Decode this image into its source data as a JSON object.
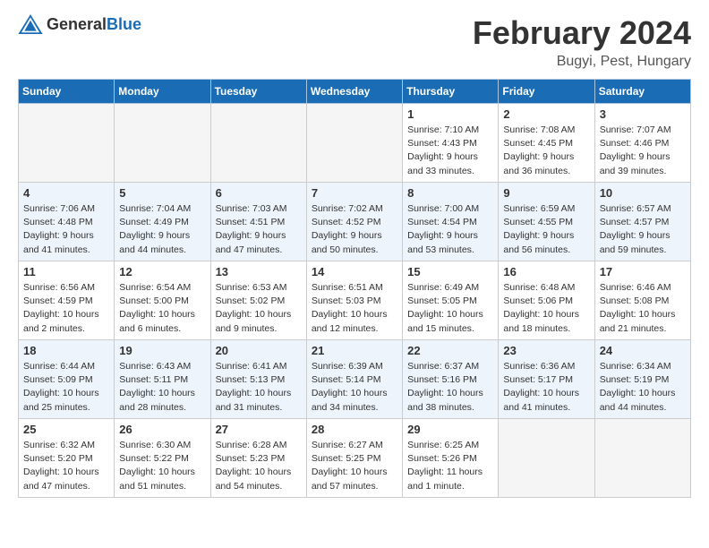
{
  "header": {
    "logo_general": "General",
    "logo_blue": "Blue",
    "month_title": "February 2024",
    "location": "Bugyi, Pest, Hungary"
  },
  "columns": [
    "Sunday",
    "Monday",
    "Tuesday",
    "Wednesday",
    "Thursday",
    "Friday",
    "Saturday"
  ],
  "weeks": [
    [
      {
        "day": "",
        "empty": true
      },
      {
        "day": "",
        "empty": true
      },
      {
        "day": "",
        "empty": true
      },
      {
        "day": "",
        "empty": true
      },
      {
        "day": "1",
        "sunrise": "Sunrise: 7:10 AM",
        "sunset": "Sunset: 4:43 PM",
        "daylight": "Daylight: 9 hours and 33 minutes."
      },
      {
        "day": "2",
        "sunrise": "Sunrise: 7:08 AM",
        "sunset": "Sunset: 4:45 PM",
        "daylight": "Daylight: 9 hours and 36 minutes."
      },
      {
        "day": "3",
        "sunrise": "Sunrise: 7:07 AM",
        "sunset": "Sunset: 4:46 PM",
        "daylight": "Daylight: 9 hours and 39 minutes."
      }
    ],
    [
      {
        "day": "4",
        "sunrise": "Sunrise: 7:06 AM",
        "sunset": "Sunset: 4:48 PM",
        "daylight": "Daylight: 9 hours and 41 minutes."
      },
      {
        "day": "5",
        "sunrise": "Sunrise: 7:04 AM",
        "sunset": "Sunset: 4:49 PM",
        "daylight": "Daylight: 9 hours and 44 minutes."
      },
      {
        "day": "6",
        "sunrise": "Sunrise: 7:03 AM",
        "sunset": "Sunset: 4:51 PM",
        "daylight": "Daylight: 9 hours and 47 minutes."
      },
      {
        "day": "7",
        "sunrise": "Sunrise: 7:02 AM",
        "sunset": "Sunset: 4:52 PM",
        "daylight": "Daylight: 9 hours and 50 minutes."
      },
      {
        "day": "8",
        "sunrise": "Sunrise: 7:00 AM",
        "sunset": "Sunset: 4:54 PM",
        "daylight": "Daylight: 9 hours and 53 minutes."
      },
      {
        "day": "9",
        "sunrise": "Sunrise: 6:59 AM",
        "sunset": "Sunset: 4:55 PM",
        "daylight": "Daylight: 9 hours and 56 minutes."
      },
      {
        "day": "10",
        "sunrise": "Sunrise: 6:57 AM",
        "sunset": "Sunset: 4:57 PM",
        "daylight": "Daylight: 9 hours and 59 minutes."
      }
    ],
    [
      {
        "day": "11",
        "sunrise": "Sunrise: 6:56 AM",
        "sunset": "Sunset: 4:59 PM",
        "daylight": "Daylight: 10 hours and 2 minutes."
      },
      {
        "day": "12",
        "sunrise": "Sunrise: 6:54 AM",
        "sunset": "Sunset: 5:00 PM",
        "daylight": "Daylight: 10 hours and 6 minutes."
      },
      {
        "day": "13",
        "sunrise": "Sunrise: 6:53 AM",
        "sunset": "Sunset: 5:02 PM",
        "daylight": "Daylight: 10 hours and 9 minutes."
      },
      {
        "day": "14",
        "sunrise": "Sunrise: 6:51 AM",
        "sunset": "Sunset: 5:03 PM",
        "daylight": "Daylight: 10 hours and 12 minutes."
      },
      {
        "day": "15",
        "sunrise": "Sunrise: 6:49 AM",
        "sunset": "Sunset: 5:05 PM",
        "daylight": "Daylight: 10 hours and 15 minutes."
      },
      {
        "day": "16",
        "sunrise": "Sunrise: 6:48 AM",
        "sunset": "Sunset: 5:06 PM",
        "daylight": "Daylight: 10 hours and 18 minutes."
      },
      {
        "day": "17",
        "sunrise": "Sunrise: 6:46 AM",
        "sunset": "Sunset: 5:08 PM",
        "daylight": "Daylight: 10 hours and 21 minutes."
      }
    ],
    [
      {
        "day": "18",
        "sunrise": "Sunrise: 6:44 AM",
        "sunset": "Sunset: 5:09 PM",
        "daylight": "Daylight: 10 hours and 25 minutes."
      },
      {
        "day": "19",
        "sunrise": "Sunrise: 6:43 AM",
        "sunset": "Sunset: 5:11 PM",
        "daylight": "Daylight: 10 hours and 28 minutes."
      },
      {
        "day": "20",
        "sunrise": "Sunrise: 6:41 AM",
        "sunset": "Sunset: 5:13 PM",
        "daylight": "Daylight: 10 hours and 31 minutes."
      },
      {
        "day": "21",
        "sunrise": "Sunrise: 6:39 AM",
        "sunset": "Sunset: 5:14 PM",
        "daylight": "Daylight: 10 hours and 34 minutes."
      },
      {
        "day": "22",
        "sunrise": "Sunrise: 6:37 AM",
        "sunset": "Sunset: 5:16 PM",
        "daylight": "Daylight: 10 hours and 38 minutes."
      },
      {
        "day": "23",
        "sunrise": "Sunrise: 6:36 AM",
        "sunset": "Sunset: 5:17 PM",
        "daylight": "Daylight: 10 hours and 41 minutes."
      },
      {
        "day": "24",
        "sunrise": "Sunrise: 6:34 AM",
        "sunset": "Sunset: 5:19 PM",
        "daylight": "Daylight: 10 hours and 44 minutes."
      }
    ],
    [
      {
        "day": "25",
        "sunrise": "Sunrise: 6:32 AM",
        "sunset": "Sunset: 5:20 PM",
        "daylight": "Daylight: 10 hours and 47 minutes."
      },
      {
        "day": "26",
        "sunrise": "Sunrise: 6:30 AM",
        "sunset": "Sunset: 5:22 PM",
        "daylight": "Daylight: 10 hours and 51 minutes."
      },
      {
        "day": "27",
        "sunrise": "Sunrise: 6:28 AM",
        "sunset": "Sunset: 5:23 PM",
        "daylight": "Daylight: 10 hours and 54 minutes."
      },
      {
        "day": "28",
        "sunrise": "Sunrise: 6:27 AM",
        "sunset": "Sunset: 5:25 PM",
        "daylight": "Daylight: 10 hours and 57 minutes."
      },
      {
        "day": "29",
        "sunrise": "Sunrise: 6:25 AM",
        "sunset": "Sunset: 5:26 PM",
        "daylight": "Daylight: 11 hours and 1 minute."
      },
      {
        "day": "",
        "empty": true
      },
      {
        "day": "",
        "empty": true
      }
    ]
  ]
}
